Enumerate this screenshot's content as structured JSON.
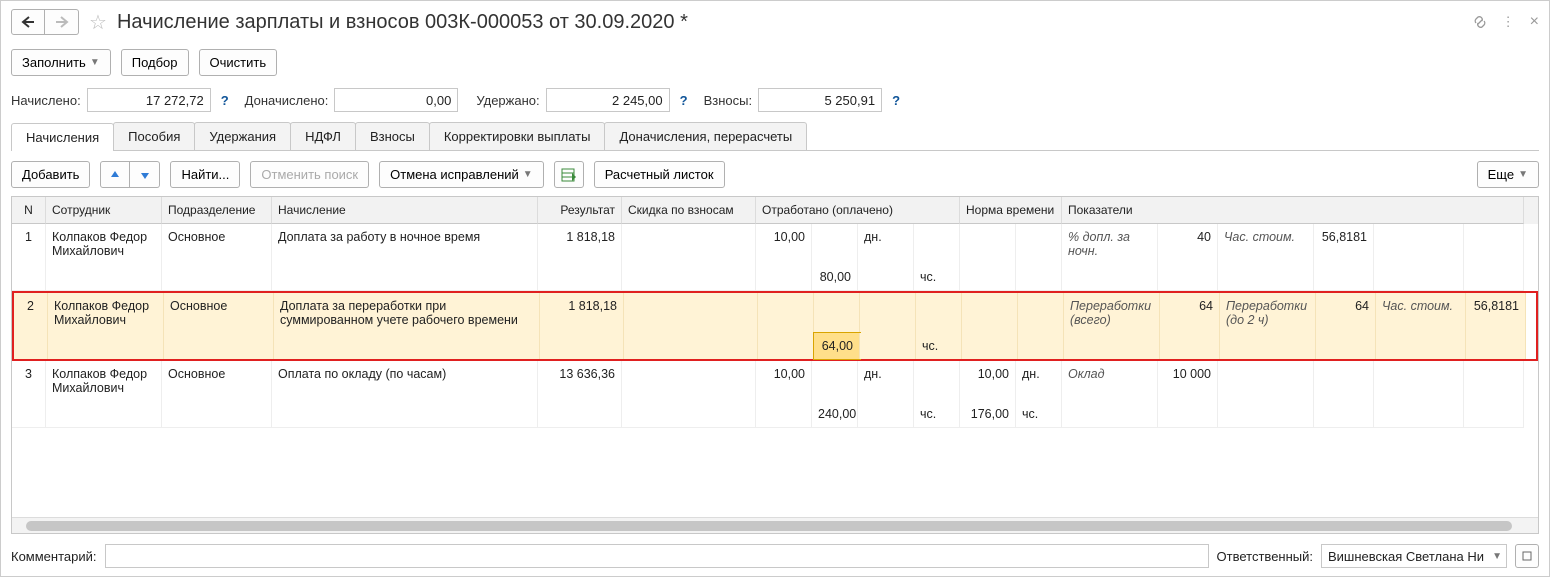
{
  "title": "Начисление зарплаты и взносов 003К-000053 от 30.09.2020 *",
  "toolbar": {
    "fill": "Заполнить",
    "pick": "Подбор",
    "clear": "Очистить"
  },
  "totals": {
    "acc_label": "Начислено:",
    "acc_value": "17 272,72",
    "add_label": "Доначислено:",
    "add_value": "0,00",
    "ded_label": "Удержано:",
    "ded_value": "2 245,00",
    "con_label": "Взносы:",
    "con_value": "5 250,91"
  },
  "tabs": [
    "Начисления",
    "Пособия",
    "Удержания",
    "НДФЛ",
    "Взносы",
    "Корректировки выплаты",
    "Доначисления, перерасчеты"
  ],
  "tools2": {
    "add": "Добавить",
    "find": "Найти...",
    "cancel_search": "Отменить поиск",
    "undo_corrections": "Отмена исправлений",
    "payslip": "Расчетный листок",
    "more": "Еще"
  },
  "grid_header": {
    "n": "N",
    "employee": "Сотрудник",
    "department": "Подразделение",
    "accrual": "Начисление",
    "result": "Результат",
    "discount": "Скидка по взносам",
    "worked": "Отработано (оплачено)",
    "norm": "Норма времени",
    "indicators": "Показатели"
  },
  "rows": [
    {
      "n": "1",
      "employee": "Колпаков Федор Михайлович",
      "department": "Основное",
      "accrual": "Доплата за работу в ночное время",
      "result": "1 818,18",
      "w1": "10,00",
      "w1u": "дн.",
      "w2": "80,00",
      "w2u": "чс.",
      "ind1_label": "% допл. за ночн.",
      "ind1_val": "40",
      "ind2_label": "Час. стоим.",
      "ind2_val": "56,8181"
    },
    {
      "n": "2",
      "employee": "Колпаков Федор Михайлович",
      "department": "Основное",
      "accrual": "Доплата за переработки при суммированном учете рабочего времени",
      "result": "1 818,18",
      "w2": "64,00",
      "w2u": "чс.",
      "ind1_label": "Переработки (всего)",
      "ind1_val": "64",
      "ind2_label": "Переработки (до 2 ч)",
      "ind2_val": "64",
      "ind3_label": "Час. стоим.",
      "ind3_val": "56,8181"
    },
    {
      "n": "3",
      "employee": "Колпаков Федор Михайлович",
      "department": "Основное",
      "accrual": "Оплата по окладу (по часам)",
      "result": "13 636,36",
      "w1": "10,00",
      "w1u": "дн.",
      "w2": "240,00",
      "w2u": "чс.",
      "n1": "10,00",
      "n1u": "дн.",
      "n2": "176,00",
      "n2u": "чс.",
      "ind1_label": "Оклад",
      "ind1_val": "10 000"
    }
  ],
  "footer": {
    "comment_label": "Комментарий:",
    "resp_label": "Ответственный:",
    "resp_value": "Вишневская Светлана Ни"
  }
}
